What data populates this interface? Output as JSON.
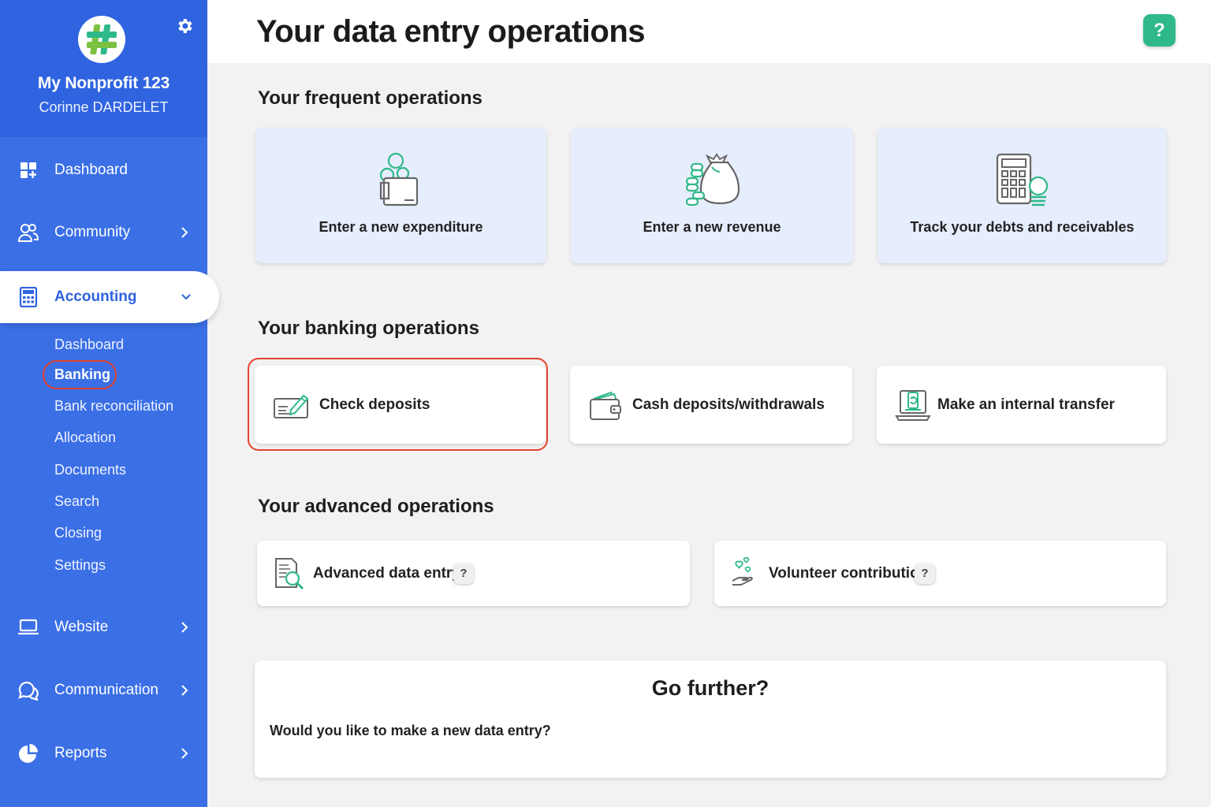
{
  "sidebar": {
    "org_name": "My Nonprofit 123",
    "user_name": "Corinne DARDELET",
    "items": {
      "dashboard": "Dashboard",
      "community": "Community",
      "accounting": "Accounting",
      "website": "Website",
      "communication": "Communication",
      "reports": "Reports"
    },
    "accounting_sub": {
      "dashboard": "Dashboard",
      "banking": "Banking",
      "bank_reconciliation": "Bank reconciliation",
      "allocation": "Allocation",
      "documents": "Documents",
      "search": "Search",
      "closing": "Closing",
      "settings": "Settings"
    },
    "active_item": "Accounting",
    "current_sub_item": "Banking"
  },
  "header": {
    "title": "Your data entry operations",
    "help_label": "?"
  },
  "sections": {
    "frequent": {
      "title": "Your frequent operations",
      "cards": {
        "expenditure": "Enter a new expenditure",
        "revenue": "Enter a new revenue",
        "debts": "Track your debts and receivables"
      }
    },
    "banking": {
      "title": "Your banking operations",
      "cards": {
        "check": "Check deposits",
        "cash": "Cash deposits/withdrawals",
        "transfer": "Make an internal transfer"
      }
    },
    "advanced": {
      "title": "Your advanced operations",
      "cards": {
        "advanced_entry": "Advanced data entry",
        "volunteer": "Volunteer contribution"
      },
      "help_badge": "?"
    }
  },
  "further": {
    "title": "Go further?",
    "text": "Would you like to make a new data entry?"
  },
  "colors": {
    "sidebar": "#3b6fe6",
    "sidebar_header": "#2f63e0",
    "accent_green": "#2fb98a",
    "highlight_red": "#e5432d",
    "card_blue": "#e6edfc"
  },
  "icons": {
    "logo": "hash-logo",
    "settings": "gear-icon",
    "dashboard": "dashboard-grid-icon",
    "community": "people-icon",
    "accounting": "calculator-icon",
    "website": "laptop-icon",
    "communication": "chat-bubbles-icon",
    "reports": "pie-chart-icon",
    "expenditure": "wallet-coins-icon",
    "revenue": "money-bag-coins-icon",
    "debts": "calculator-coin-icon",
    "check": "check-pen-icon",
    "cash": "wallet-cash-icon",
    "transfer": "laptop-transfer-icon",
    "advanced_entry": "document-magnifier-icon",
    "volunteer": "hand-hearts-icon"
  }
}
